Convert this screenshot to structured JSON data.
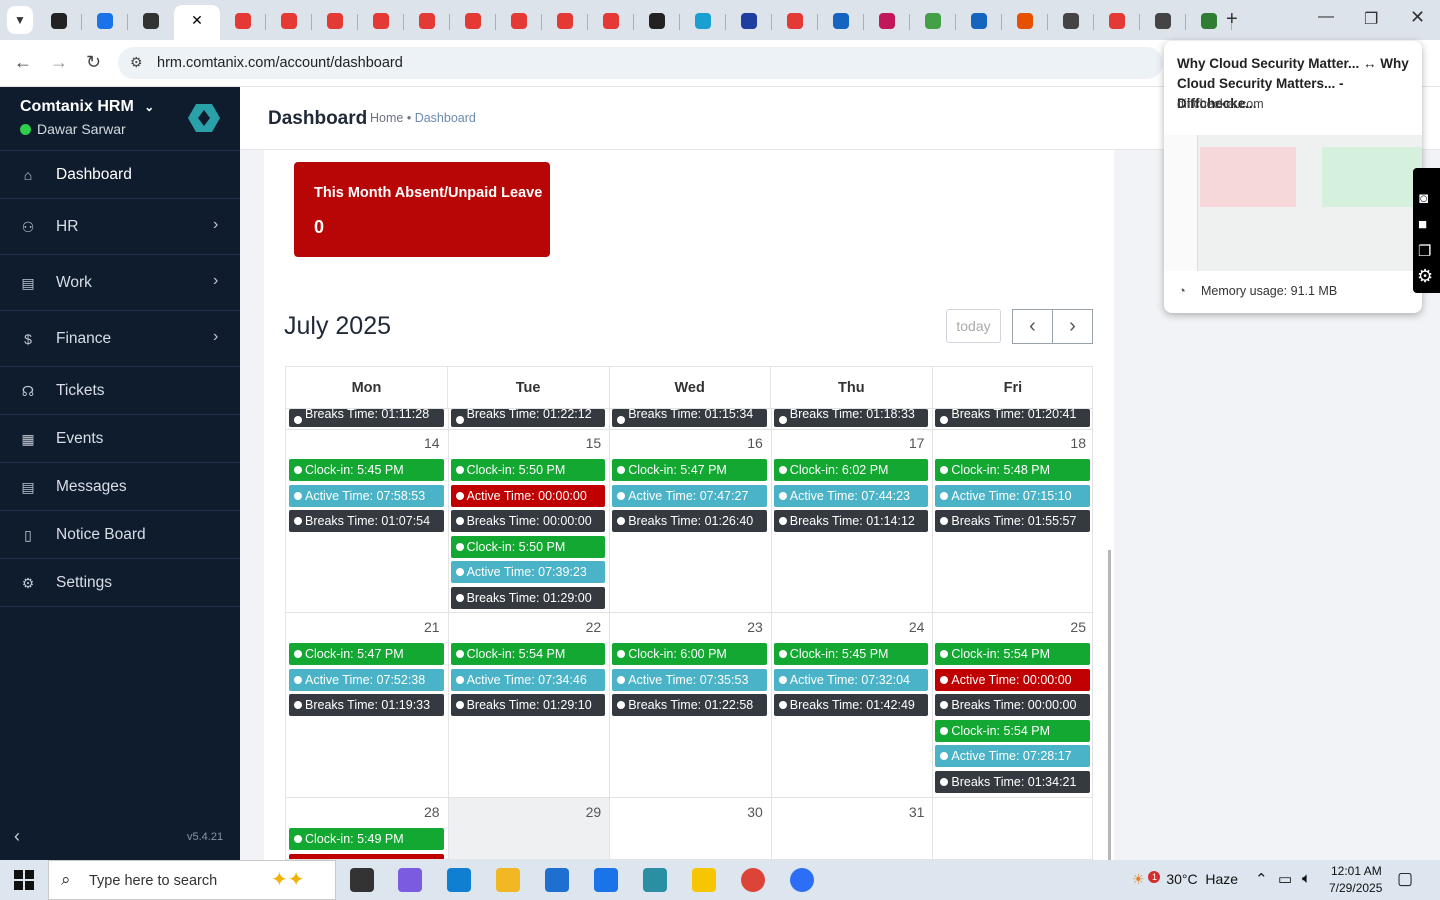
{
  "browser": {
    "url": "hrm.comtanix.com/account/dashboard",
    "tab_colors": [
      "#222",
      "#1a73e8",
      "#333",
      "#fff",
      "#e53935",
      "#e53935",
      "#e53935",
      "#e53935",
      "#e53935",
      "#e53935",
      "#e53935",
      "#e53935",
      "#e53935",
      "#222",
      "#1a9fd0",
      "#1f3fa0",
      "#e53935",
      "#1565c0",
      "#c2185b",
      "#43a047",
      "#1565c0",
      "#e65100",
      "#444",
      "#e53935",
      "#444",
      "#2e7d32"
    ],
    "new_tab": "+"
  },
  "popup": {
    "title": "Why Cloud Security Matter... ↔ Why Cloud Security Matters... - Diffchecke...",
    "url": "diffchecker.com",
    "memory": "Memory usage: 91.1 MB"
  },
  "sidebar": {
    "brand": "Comtanix HRM",
    "user": "Dawar Sarwar",
    "version": "v5.4.21",
    "items": [
      {
        "label": "Dashboard",
        "icon": "home-icon"
      },
      {
        "label": "HR",
        "icon": "users-icon"
      },
      {
        "label": "Work",
        "icon": "briefcase-icon"
      },
      {
        "label": "Finance",
        "icon": "dollar-icon"
      },
      {
        "label": "Tickets",
        "icon": "headset-icon"
      },
      {
        "label": "Events",
        "icon": "calendar-icon"
      },
      {
        "label": "Messages",
        "icon": "message-icon"
      },
      {
        "label": "Notice Board",
        "icon": "clipboard-icon"
      },
      {
        "label": "Settings",
        "icon": "gear-icon"
      }
    ]
  },
  "header": {
    "title": "Dashboard",
    "crumb_home": "Home",
    "crumb_sep": "•",
    "crumb_current": "Dashboard"
  },
  "absent_card": {
    "title": "This Month Absent/Unpaid Leave",
    "value": "0"
  },
  "calendar": {
    "month": "July 2025",
    "today": "today",
    "days": [
      "Mon",
      "Tue",
      "Wed",
      "Thu",
      "Fri"
    ],
    "prev_breaks": [
      "Breaks Time: 01:11:28",
      "Breaks Time: 01:22:12",
      "Breaks Time: 01:15:34",
      "Breaks Time: 01:18:33",
      "Breaks Time: 01:20:41"
    ],
    "week1_nums": [
      "14",
      "15",
      "16",
      "17",
      "18"
    ],
    "week1": [
      [
        "Clock-in: 5:45 PM",
        "Active Time: 07:58:53",
        "Breaks Time: 01:07:54"
      ],
      [
        "Clock-in: 5:50 PM",
        "Active Time: 00:00:00",
        "Breaks Time: 00:00:00",
        "Clock-in: 5:50 PM",
        "Active Time: 07:39:23",
        "Breaks Time: 01:29:00"
      ],
      [
        "Clock-in: 5:47 PM",
        "Active Time: 07:47:27",
        "Breaks Time: 01:26:40"
      ],
      [
        "Clock-in: 6:02 PM",
        "Active Time: 07:44:23",
        "Breaks Time: 01:14:12"
      ],
      [
        "Clock-in: 5:48 PM",
        "Active Time: 07:15:10",
        "Breaks Time: 01:55:57"
      ]
    ],
    "week2_nums": [
      "21",
      "22",
      "23",
      "24",
      "25"
    ],
    "week2": [
      [
        "Clock-in: 5:47 PM",
        "Active Time: 07:52:38",
        "Breaks Time: 01:19:33"
      ],
      [
        "Clock-in: 5:54 PM",
        "Active Time: 07:34:46",
        "Breaks Time: 01:29:10"
      ],
      [
        "Clock-in: 6:00 PM",
        "Active Time: 07:35:53",
        "Breaks Time: 01:22:58"
      ],
      [
        "Clock-in: 5:45 PM",
        "Active Time: 07:32:04",
        "Breaks Time: 01:42:49"
      ],
      [
        "Clock-in: 5:54 PM",
        "Active Time: 00:00:00",
        "Breaks Time: 00:00:00",
        "Clock-in: 5:54 PM",
        "Active Time: 07:28:17",
        "Breaks Time: 01:34:21"
      ]
    ],
    "week3_nums": [
      "28",
      "29",
      "30",
      "31",
      ""
    ],
    "week3": [
      [
        "Clock-in: 5:49 PM"
      ]
    ]
  },
  "taskbar": {
    "search_placeholder": "Type here to search",
    "weather": "30°C  Haze",
    "weather_badge": "1",
    "time": "12:01 AM",
    "date": "7/29/2025"
  }
}
